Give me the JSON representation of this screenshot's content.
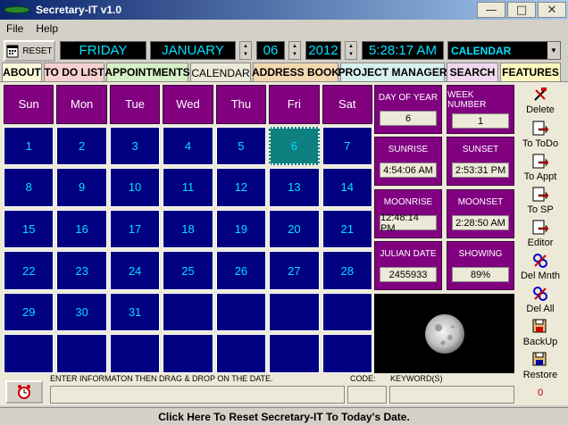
{
  "window": {
    "title": "Secretary-IT v1.0",
    "minimize_icon": "minimize-icon",
    "maximize_icon": "maximize-icon",
    "close_icon": "close-icon"
  },
  "menu": {
    "items": [
      {
        "label": "File"
      },
      {
        "label": "Help"
      }
    ]
  },
  "toolbar": {
    "reset_label": "RESET",
    "weekday": "FRIDAY",
    "month": "JANUARY",
    "day": "06",
    "year": "2012",
    "time": "5:28:17 AM",
    "view": "CALENDAR"
  },
  "tabs": [
    {
      "label": "ABOUT",
      "color": "#fcf8d8"
    },
    {
      "label": "TO DO LIST",
      "color": "#f8d0d0"
    },
    {
      "label": "APPOINTMENTS",
      "color": "#d8f0c8"
    },
    {
      "label": "CALENDAR",
      "color": "#ece9d8",
      "active": true
    },
    {
      "label": "ADDRESS BOOK",
      "color": "#f4d8b0"
    },
    {
      "label": "PROJECT MANAGER",
      "color": "#d8f0f0"
    },
    {
      "label": "SEARCH",
      "color": "#f0d8f0"
    },
    {
      "label": "FEATURES",
      "color": "#fcf8c0"
    }
  ],
  "calendar": {
    "weekdays": [
      "Sun",
      "Mon",
      "Tue",
      "Wed",
      "Thu",
      "Fri",
      "Sat"
    ],
    "weeks": [
      [
        "1",
        "2",
        "3",
        "4",
        "5",
        "6",
        "7"
      ],
      [
        "8",
        "9",
        "10",
        "11",
        "12",
        "13",
        "14"
      ],
      [
        "15",
        "16",
        "17",
        "18",
        "19",
        "20",
        "21"
      ],
      [
        "22",
        "23",
        "24",
        "25",
        "26",
        "27",
        "28"
      ],
      [
        "29",
        "30",
        "31",
        "",
        "",
        "",
        ""
      ],
      [
        "",
        "",
        "",
        "",
        "",
        "",
        ""
      ]
    ],
    "today": "6"
  },
  "info": {
    "day_of_year": {
      "label": "DAY OF YEAR",
      "value": "6"
    },
    "week_number": {
      "label": "WEEK NUMBER",
      "value": "1"
    },
    "sunrise": {
      "label": "SUNRISE",
      "value": "4:54:06 AM"
    },
    "sunset": {
      "label": "SUNSET",
      "value": "2:53:31 PM"
    },
    "moonrise": {
      "label": "MOONRISE",
      "value": "12:48:14 PM"
    },
    "moonset": {
      "label": "MOONSET",
      "value": "2:28:50 AM"
    },
    "julian_date": {
      "label": "JULIAN DATE",
      "value": "2455933"
    },
    "showing": {
      "label": "SHOWING",
      "value": "89%"
    }
  },
  "moon": {
    "illumination": 0.89
  },
  "actions": [
    {
      "label": "Delete",
      "icon": "delete-icon"
    },
    {
      "label": "To ToDo",
      "icon": "to-todo-icon"
    },
    {
      "label": "To Appt",
      "icon": "to-appt-icon"
    },
    {
      "label": "To SP",
      "icon": "to-sp-icon"
    },
    {
      "label": "Editor",
      "icon": "editor-icon"
    },
    {
      "label": "Del Mnth",
      "icon": "delete-month-icon"
    },
    {
      "label": "Del All",
      "icon": "delete-all-icon"
    },
    {
      "label": "BackUp",
      "icon": "backup-icon"
    },
    {
      "label": "Restore",
      "icon": "restore-icon"
    }
  ],
  "counter": "0",
  "entry": {
    "label": "ENTER INFORMATON THEN DRAG & DROP ON THE DATE.",
    "code_label": "CODE:",
    "keywords_label": "KEYWORD(S)",
    "alarm_icon": "alarm-clock-icon"
  },
  "status": {
    "text": "Click Here To Reset Secretary-IT To Today's Date."
  }
}
